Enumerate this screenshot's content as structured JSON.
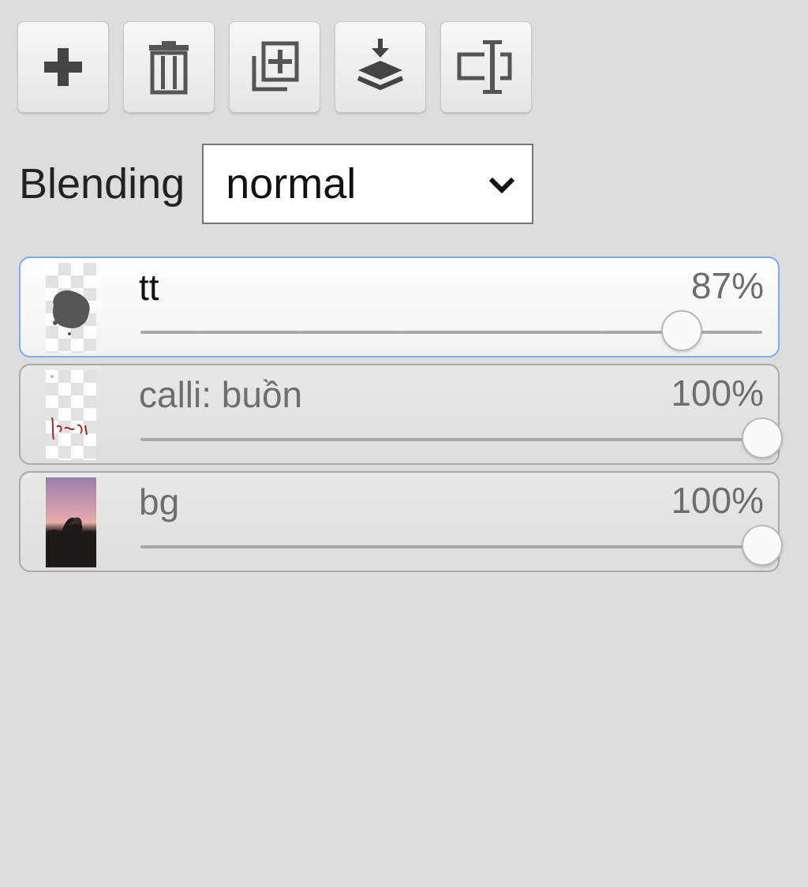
{
  "toolbar": {
    "buttons": [
      {
        "name": "add-layer",
        "icon": "plus-icon"
      },
      {
        "name": "delete-layer",
        "icon": "trash-icon"
      },
      {
        "name": "duplicate-layer",
        "icon": "duplicate-icon"
      },
      {
        "name": "merge-down",
        "icon": "merge-down-icon"
      },
      {
        "name": "rename-layer",
        "icon": "rename-icon"
      }
    ]
  },
  "blending": {
    "label": "Blending",
    "selected": "normal"
  },
  "layers": [
    {
      "name": "tt",
      "opacity_label": "87%",
      "opacity": 0.87,
      "active": true
    },
    {
      "name": "calli: buồn",
      "opacity_label": "100%",
      "opacity": 1.0,
      "active": false
    },
    {
      "name": "bg",
      "opacity_label": "100%",
      "opacity": 1.0,
      "active": false
    }
  ]
}
